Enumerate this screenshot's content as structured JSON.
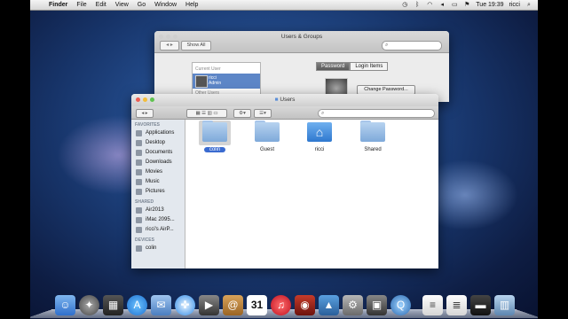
{
  "menubar": {
    "app": "Finder",
    "items": [
      "File",
      "Edit",
      "View",
      "Go",
      "Window",
      "Help"
    ],
    "clock": "Tue 19:39",
    "user": "ricci"
  },
  "users_groups": {
    "title": "Users & Groups",
    "show_all": "Show All",
    "current_user_header": "Current User",
    "user_name": "ricci",
    "user_role": "Admin",
    "other_users_header": "Other Users",
    "tab_password": "Password",
    "tab_login_items": "Login Items",
    "change_password": "Change Password..."
  },
  "finder": {
    "title": "Users",
    "sidebar": {
      "favorites_header": "FAVORITES",
      "favorites": [
        "Applications",
        "Desktop",
        "Documents",
        "Downloads",
        "Movies",
        "Music",
        "Pictures"
      ],
      "shared_header": "SHARED",
      "shared": [
        "Air2013",
        "iMac 2095...",
        "ricci's AirP..."
      ],
      "devices_header": "DEVICES",
      "devices": [
        "colin"
      ]
    },
    "folders": [
      "colin",
      "Guest",
      "ricci",
      "Shared"
    ]
  },
  "dock": {
    "calendar_day": "31"
  },
  "icons": {
    "apple": "apple-icon",
    "search": "search-icon",
    "home": "home-folder-icon",
    "gear": "gear-icon"
  }
}
